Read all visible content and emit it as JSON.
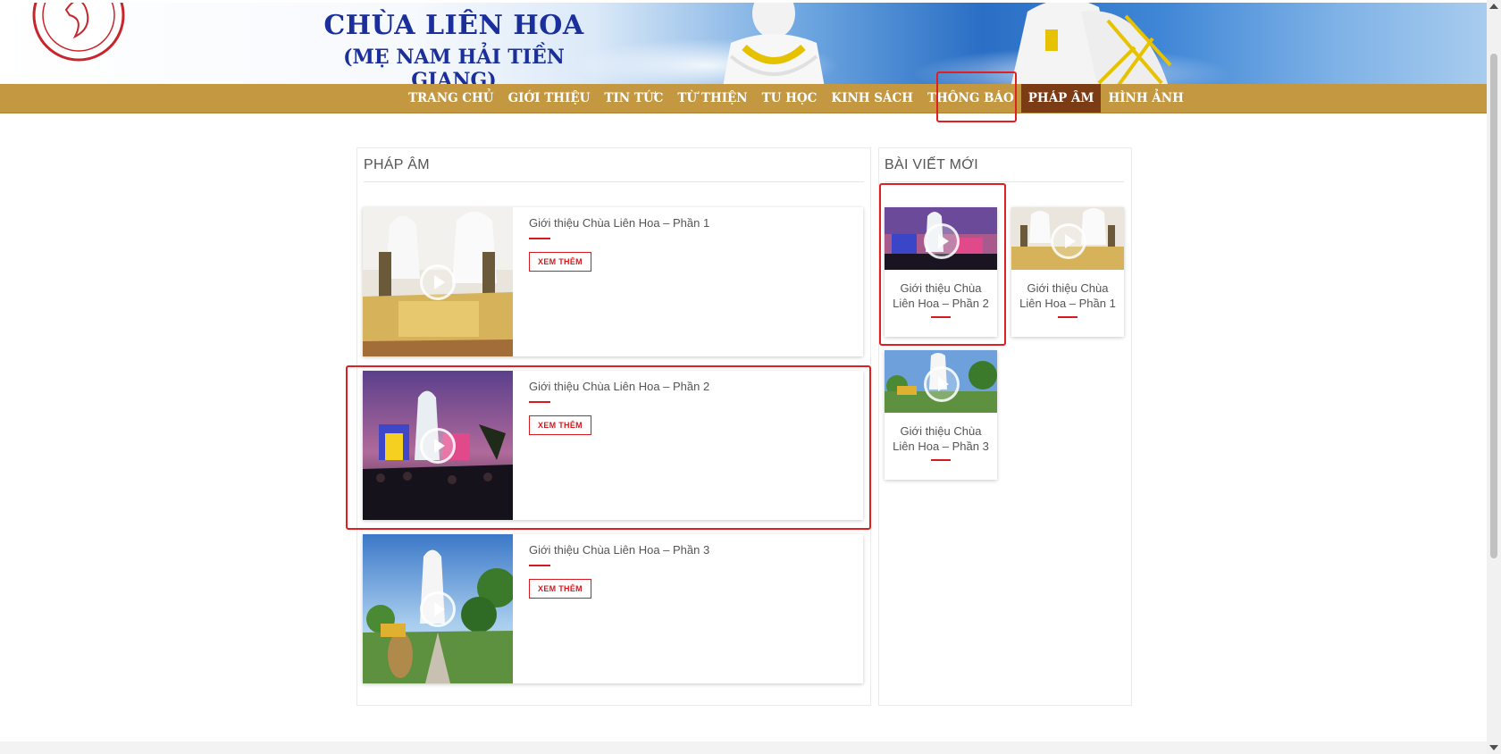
{
  "header": {
    "title": "CHÙA LIÊN HOA",
    "subtitle": "(MẸ NAM HẢI TIỀN GIANG)"
  },
  "nav": {
    "items": [
      {
        "label": "TRANG CHỦ"
      },
      {
        "label": "GIỚI THIỆU"
      },
      {
        "label": "TIN TỨC"
      },
      {
        "label": "TỪ THIỆN"
      },
      {
        "label": "TU HỌC"
      },
      {
        "label": "KINH SÁCH"
      },
      {
        "label": "THÔNG BÁO"
      },
      {
        "label": "PHÁP ÂM",
        "active": true
      },
      {
        "label": "HÌNH ẢNH"
      }
    ]
  },
  "main": {
    "heading": "PHÁP ÂM",
    "posts": [
      {
        "title": "Giới thiệu Chùa Liên Hoa – Phần 1",
        "button": "XEM THÊM",
        "thumbnail": "statues-golden-altar"
      },
      {
        "title": "Giới thiệu Chùa Liên Hoa – Phần 2",
        "button": "XEM THÊM",
        "thumbnail": "night-festival-statue"
      },
      {
        "title": "Giới thiệu Chùa Liên Hoa – Phần 3",
        "button": "XEM THÊM",
        "thumbnail": "garden-statues-daytime"
      }
    ]
  },
  "sidebar": {
    "heading": "BÀI VIẾT MỚI",
    "posts": [
      {
        "title": "Giới thiệu Chùa Liên Hoa – Phần 2",
        "thumbnail": "night-festival-statue"
      },
      {
        "title": "Giới thiệu Chùa Liên Hoa – Phần 1",
        "thumbnail": "statues-golden-altar"
      },
      {
        "title": "Giới thiệu Chùa Liên Hoa – Phần 3",
        "thumbnail": "garden-statues-daytime"
      }
    ]
  },
  "colors": {
    "nav_bg": "#c39840",
    "nav_active": "#7b3b14",
    "title_blue": "#1b2f9c",
    "accent_red": "#d71920",
    "highlight_box": "#e02020"
  }
}
